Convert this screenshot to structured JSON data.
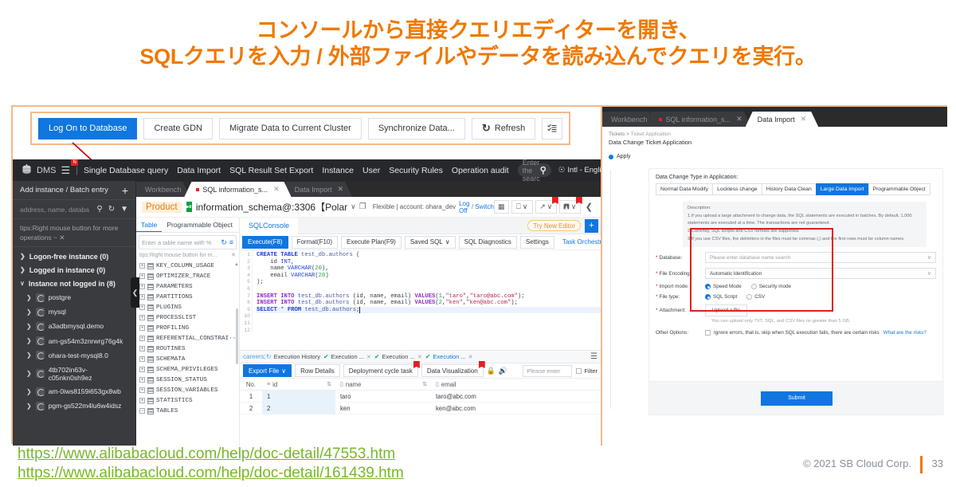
{
  "slide": {
    "title_line1": "コンソールから直接クエリエディターを開き、",
    "title_line2": "SQLクエリを入力 / 外部ファイルやデータを読み込んでクエリを実行。",
    "title_color": "#F07800",
    "url1": "https://www.alibabacloud.com/help/doc-detail/47553.htm",
    "url2": "https://www.alibabacloud.com/help/doc-detail/161439.htm",
    "url_color": "#76B82A",
    "copyright": "© 2021 SB Cloud Corp.",
    "page_number": "33"
  },
  "toolbar": {
    "buttons": [
      {
        "label": "Log On to Database",
        "primary": true
      },
      {
        "label": "Create GDN",
        "primary": false
      },
      {
        "label": "Migrate Data to Current Cluster",
        "primary": false
      },
      {
        "label": "Synchronize Data...",
        "primary": false
      }
    ],
    "refresh_label": "Refresh",
    "refresh_icon": "refresh-icon",
    "list_icon": "checklist-icon"
  },
  "dms": {
    "logo_text": "DMS",
    "logo_icon": "database-icon",
    "menu_icon": "hamburger-icon",
    "menu_badge": "N",
    "nav": [
      "Single Database query",
      "Data Import",
      "SQL Result Set Export",
      "Instance",
      "User",
      "Security Rules",
      "Operation audit"
    ],
    "search_placeholder": "Enter the searc",
    "search_icon": "search-icon",
    "language": "Intl - English",
    "language_icon": "globe-icon"
  },
  "instance_sidebar": {
    "add_label": "Add instance / Batch entry",
    "add_icon": "plus-icon",
    "search_placeholder": "address, name, databa",
    "search_icon": "search-icon",
    "refresh_icon": "refresh-icon",
    "filter_icon": "filter-icon",
    "tip": "tips:Right mouse button for more operations ~",
    "tip_close_icon": "close-icon",
    "groups": [
      {
        "label": "Logon-free instance  (0)",
        "expanded": false
      },
      {
        "label": "Logged in instance  (0)",
        "expanded": false
      },
      {
        "label": "Instance not logged in  (8)",
        "expanded": true
      }
    ],
    "instances": [
      "postgre",
      "mysql",
      "a3adbmysql.demo",
      "am-gs54m3znrwrg76g4k",
      "ohara-test-mysql8.0",
      "4tb702in63v-c05nkn0sh9ez",
      "am-0iws8159i653gx8wb",
      "pgm-gs522m4lu6w4idsz"
    ],
    "collapse_icon": "chevron-left-icon"
  },
  "doc_tabs": [
    {
      "label": "Workbench",
      "active": false,
      "closable": false,
      "dot": false
    },
    {
      "label": "SQL information_s...",
      "active": true,
      "closable": true,
      "dot": true
    },
    {
      "label": "Data Import",
      "active": false,
      "closable": true,
      "dot": false
    }
  ],
  "connection": {
    "product_tag": "Product",
    "engine_icon": "polardb-icon",
    "name": "information_schema@:3306",
    "bracket": "【Polar",
    "chevron_icon": "chevron-down-icon",
    "copy_icon": "copy-icon",
    "account_text": "Flexible | account: ohara_dev",
    "logoff_label": "Log Off",
    "slash": "/",
    "switch_label": "Switch",
    "icons": [
      "grid-icon",
      "monitor-icon",
      "export-icon",
      "save-icon",
      "share-icon"
    ]
  },
  "table_panel": {
    "tabs": [
      {
        "label": "Table",
        "active": true
      },
      {
        "label": "Programmable Object",
        "active": false
      }
    ],
    "search_placeholder": "Enter a table name with %",
    "refresh_icon": "refresh-icon",
    "menu_icon": "list-icon",
    "tip": "tips:Right mouse button for m...",
    "tip_close_icon": "close-icon",
    "tables": [
      "KEY_COLUMN_USAGE",
      "OPTIMIZER_TRACE",
      "PARAMETERS",
      "PARTITIONS",
      "PLUGINS",
      "PROCESSLIST",
      "PROFILING",
      "REFERENTIAL_CONSTRAI···",
      "ROUTINES",
      "SCHEMATA",
      "SCHEMA_PRIVILEGES",
      "SESSION_STATUS",
      "SESSION_VARIABLES",
      "STATISTICS",
      "TABLES"
    ]
  },
  "editor": {
    "console_tab": "SQLConsole",
    "try_new_editor": "Try New Editor",
    "add_icon": "plus-icon",
    "actions": [
      {
        "label": "Execute(F8)",
        "style": "primary"
      },
      {
        "label": "Format(F10)",
        "style": "normal"
      },
      {
        "label": "Execute Plan(F9)",
        "style": "normal"
      },
      {
        "label": "Saved SQL",
        "style": "normal",
        "caret": true
      },
      {
        "label": "SQL Diagnostics",
        "style": "normal"
      },
      {
        "label": "Settings",
        "style": "normal"
      },
      {
        "label": "Task Orchestration",
        "style": "link"
      }
    ],
    "line_numbers": [
      "1",
      "2",
      "3",
      "4",
      "5",
      "6",
      "7",
      "8",
      "9",
      "10",
      "11",
      "12"
    ],
    "sql_lines": [
      "CREATE TABLE test_db.authors (",
      "    id INT,",
      "    name VARCHAR(20),",
      "    email VARCHAR(20)",
      ");",
      "",
      "INSERT INTO test_db.authors (id, name, email) VALUES(1,\"taro\",\"taro@abc.com\");",
      "INSERT INTO test_db.authors (id, name, email) VALUES(2,\"ken\",\"ken@abc.com\");",
      "",
      "SELECT * FROM test_db.authors;",
      "",
      ""
    ]
  },
  "results": {
    "tabs": [
      {
        "label": "Execution History",
        "icon": "history-icon",
        "active": false,
        "closable": false
      },
      {
        "label": "Execution ...",
        "icon": "success-icon",
        "active": false,
        "closable": true
      },
      {
        "label": "Execution ...",
        "icon": "success-icon",
        "active": false,
        "closable": true
      },
      {
        "label": "Execution ...",
        "icon": "success-icon",
        "active": true,
        "closable": true
      }
    ],
    "menu_icon": "more-icon",
    "actions": [
      {
        "label": "Export File",
        "style": "primary",
        "caret": true
      },
      {
        "label": "Row Details",
        "style": "normal"
      },
      {
        "label": "Deployment cycle task",
        "style": "normal",
        "flag": "N"
      },
      {
        "label": "Data Visualization",
        "style": "normal",
        "flag": "N"
      }
    ],
    "lock_icon": "lock-icon",
    "sound_icon": "sound-icon",
    "filter_placeholder": "Please enter",
    "filter_label": "Filter",
    "columns": [
      "No.",
      "id",
      "name",
      "email"
    ],
    "rows": [
      {
        "no": "1",
        "id": "1",
        "name": "taro",
        "email": "taro@abc.com"
      },
      {
        "no": "2",
        "id": "2",
        "name": "ken",
        "email": "ken@abc.com"
      }
    ]
  },
  "import_panel": {
    "tabs": [
      {
        "label": "Workbench",
        "active": false,
        "closable": false,
        "dot": false
      },
      {
        "label": "SQL information_s...",
        "active": false,
        "closable": true,
        "dot": true
      },
      {
        "label": "Data Import",
        "active": true,
        "closable": true,
        "dot": false
      }
    ],
    "breadcrumb_root": "Tickets",
    "breadcrumb_sep": ">",
    "breadcrumb_current": "Ticket Application",
    "page_title": "Data Change Ticket Application",
    "step_label": "Apply",
    "change_type_label": "Data Change Type in Application:",
    "change_types": [
      {
        "label": "Normal Data Modify",
        "selected": false
      },
      {
        "label": "Lockless change",
        "selected": false
      },
      {
        "label": "History Data Clean",
        "selected": false
      },
      {
        "label": "Large Data Import",
        "selected": true
      },
      {
        "label": "Programmable Object",
        "selected": false
      }
    ],
    "description_heading": "Description:",
    "description_lines": [
      "1.If you upload a large attachment to change data, the SQL statements are executed in batches. By default, 1,000 statements are executed at a time. The transactions are not guaranteed.",
      "2.Currently, SQL scripts and CSV formats are supported.",
      "3.If you use CSV files, the delimiters in the files must be commas (,) and the first rows must be column names."
    ],
    "fields": {
      "database_label": "Database:",
      "database_placeholder": "Please enter database name search",
      "file_encoding_label": "File Encoding:",
      "file_encoding_value": "Automatic Identification",
      "import_mode_label": "Import mode:",
      "import_mode_options": [
        {
          "label": "Speed Mode",
          "selected": true
        },
        {
          "label": "Security mode",
          "selected": false
        }
      ],
      "file_type_label": "File type:",
      "file_type_options": [
        {
          "label": "SQL Script",
          "selected": true
        },
        {
          "label": "CSV",
          "selected": false
        }
      ],
      "attachment_label": "Attachment:",
      "upload_button": "Upload a file",
      "upload_hint": "You can upload only TXT, SQL, and CSV files no greater than 5 GB.",
      "other_options_label": "Other Options:",
      "ignore_errors_label": "Ignore errors, that is, skip when SQL execution fails, there are certain risks",
      "risk_link": "What are the risks?"
    },
    "submit_label": "Submit",
    "highlight_color": "#e02020"
  }
}
